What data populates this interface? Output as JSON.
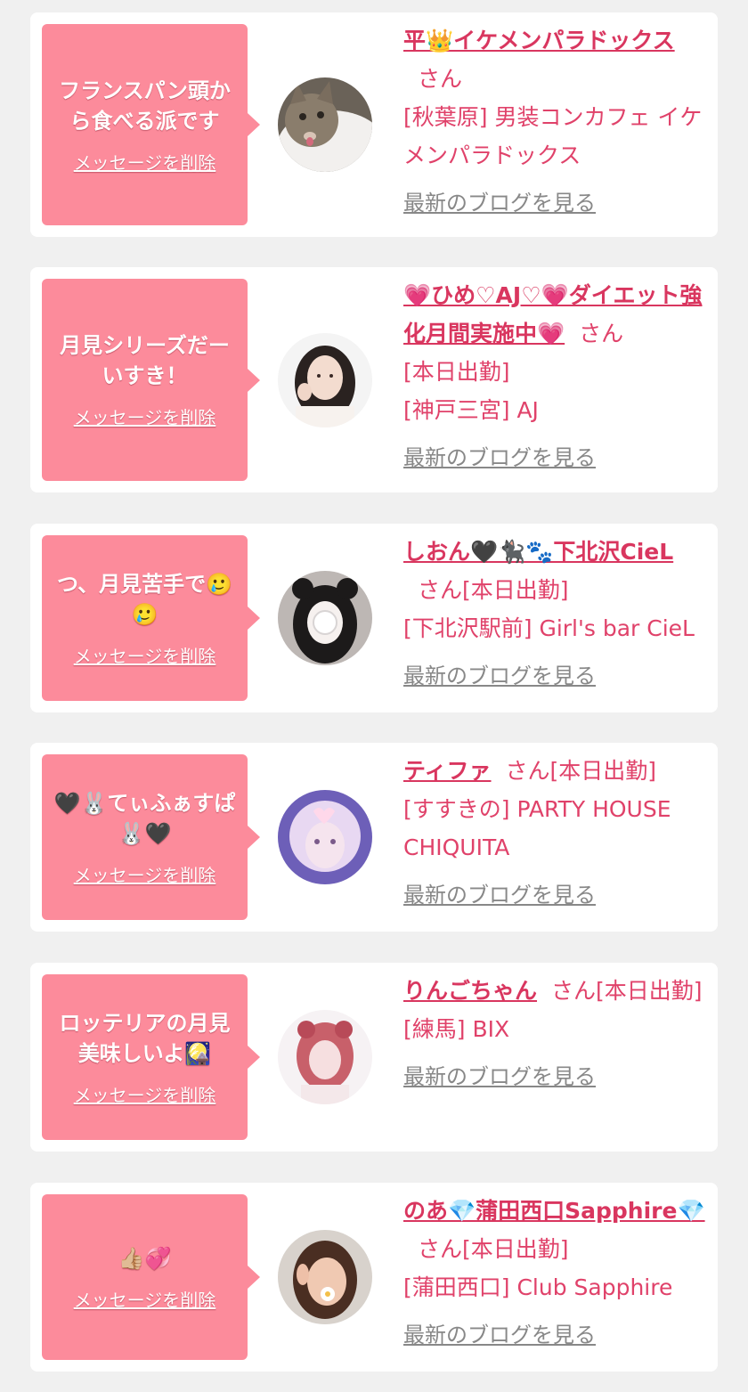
{
  "delete_label": "メッセージを削除",
  "blog_label": "最新のブログを見る",
  "items": [
    {
      "message": "フランスパン頭から食べる派です",
      "name": "平👑イケメンパラドックス",
      "suffix": "さん",
      "shop": "[秋葉原] 男装コンカフェ イケメンパラドックス",
      "avatar_icon": "cat-photo"
    },
    {
      "message": "月見シリーズだーいすき！",
      "name": "💗ひめ♡AJ♡💗ダイエット強化月間実施中💗",
      "suffix": "さん",
      "status": "[本日出勤]",
      "shop": "[神戸三宮] AJ",
      "avatar_icon": "girl-photo"
    },
    {
      "message": "つ、月見苦手で🥲🥲",
      "name": "しおん🖤🐈‍⬛🐾下北沢CieL",
      "suffix": "さん[本日出勤]",
      "shop": "[下北沢駅前] Girl's bar CieL",
      "avatar_icon": "girl-photo"
    },
    {
      "message": "🖤🐰てぃふぁすぱ🐰🖤",
      "name": "ティファ",
      "suffix": "さん[本日出勤]",
      "shop": "[すすきの] PARTY HOUSE CHIQUITA",
      "avatar_icon": "girl-photo"
    },
    {
      "message": "ロッテリアの月見美味しいよ🎑",
      "name": "りんごちゃん",
      "suffix": "さん[本日出勤]",
      "shop": "[練馬] BIX",
      "avatar_icon": "girl-photo"
    },
    {
      "message": "👍🏼💞",
      "name": "のあ💎蒲田西口Sapphire💎",
      "suffix": "さん[本日出勤]",
      "shop": "[蒲田西口] Club Sapphire",
      "avatar_icon": "girl-photo"
    }
  ]
}
